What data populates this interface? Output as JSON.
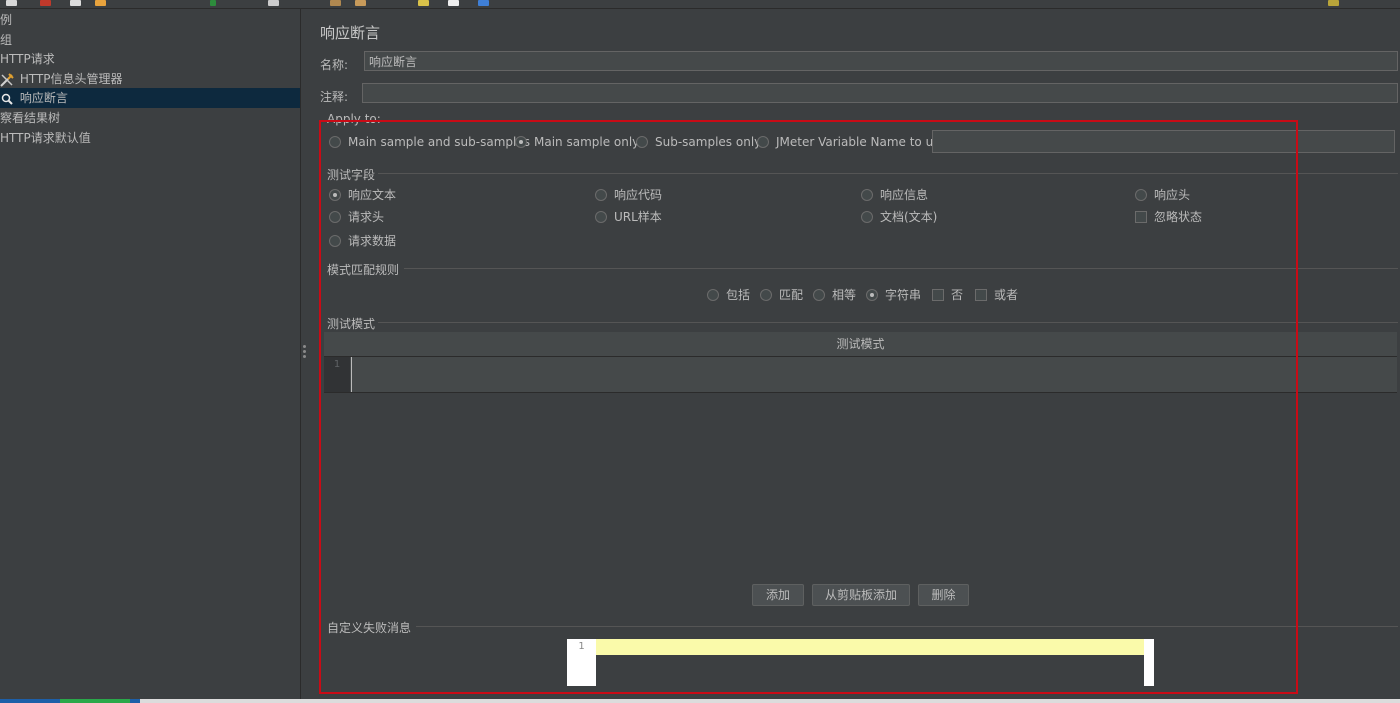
{
  "sidebar": {
    "items": [
      {
        "label": "例"
      },
      {
        "label": "组"
      },
      {
        "label": "HTTP请求"
      },
      {
        "label": "HTTP信息头管理器",
        "icon": "wrench-icon"
      },
      {
        "label": "响应断言",
        "icon": "magnifier-icon"
      },
      {
        "label": "察看结果树"
      },
      {
        "label": "HTTP请求默认值"
      }
    ]
  },
  "form": {
    "title": "响应断言",
    "name_label": "名称:",
    "name_value": "响应断言",
    "comment_label": "注释:",
    "comment_value": ""
  },
  "apply_to": {
    "title": "Apply to:",
    "options": [
      "Main sample and sub-samples",
      "Main sample only",
      "Sub-samples only",
      "JMeter Variable Name to use"
    ],
    "selected": "Main sample only",
    "variable_value": ""
  },
  "test_field": {
    "title": "测试字段",
    "radios": [
      "响应文本",
      "响应代码",
      "响应信息",
      "响应头",
      "请求头",
      "URL样本",
      "文档(文本)",
      "请求数据"
    ],
    "selected": "响应文本",
    "ignore_status_label": "忽略状态"
  },
  "pattern_rules": {
    "title": "模式匹配规则",
    "radios": [
      "包括",
      "匹配",
      "相等",
      "字符串"
    ],
    "selected": "字符串",
    "not_label": "否",
    "or_label": "或者"
  },
  "test_patterns": {
    "title": "测试模式",
    "column_header": "测试模式",
    "line_number": "1",
    "rows": [
      ""
    ],
    "add_button": "添加",
    "add_clipboard_button": "从剪贴板添加",
    "delete_button": "删除"
  },
  "custom_failure": {
    "title": "自定义失败消息",
    "line_number": "1",
    "value": ""
  },
  "colors": {
    "background": "#3c3f41",
    "selection": "#0d293e",
    "highlight_frame": "#c90b16",
    "editor_line_highlight": "#fafaaa"
  }
}
